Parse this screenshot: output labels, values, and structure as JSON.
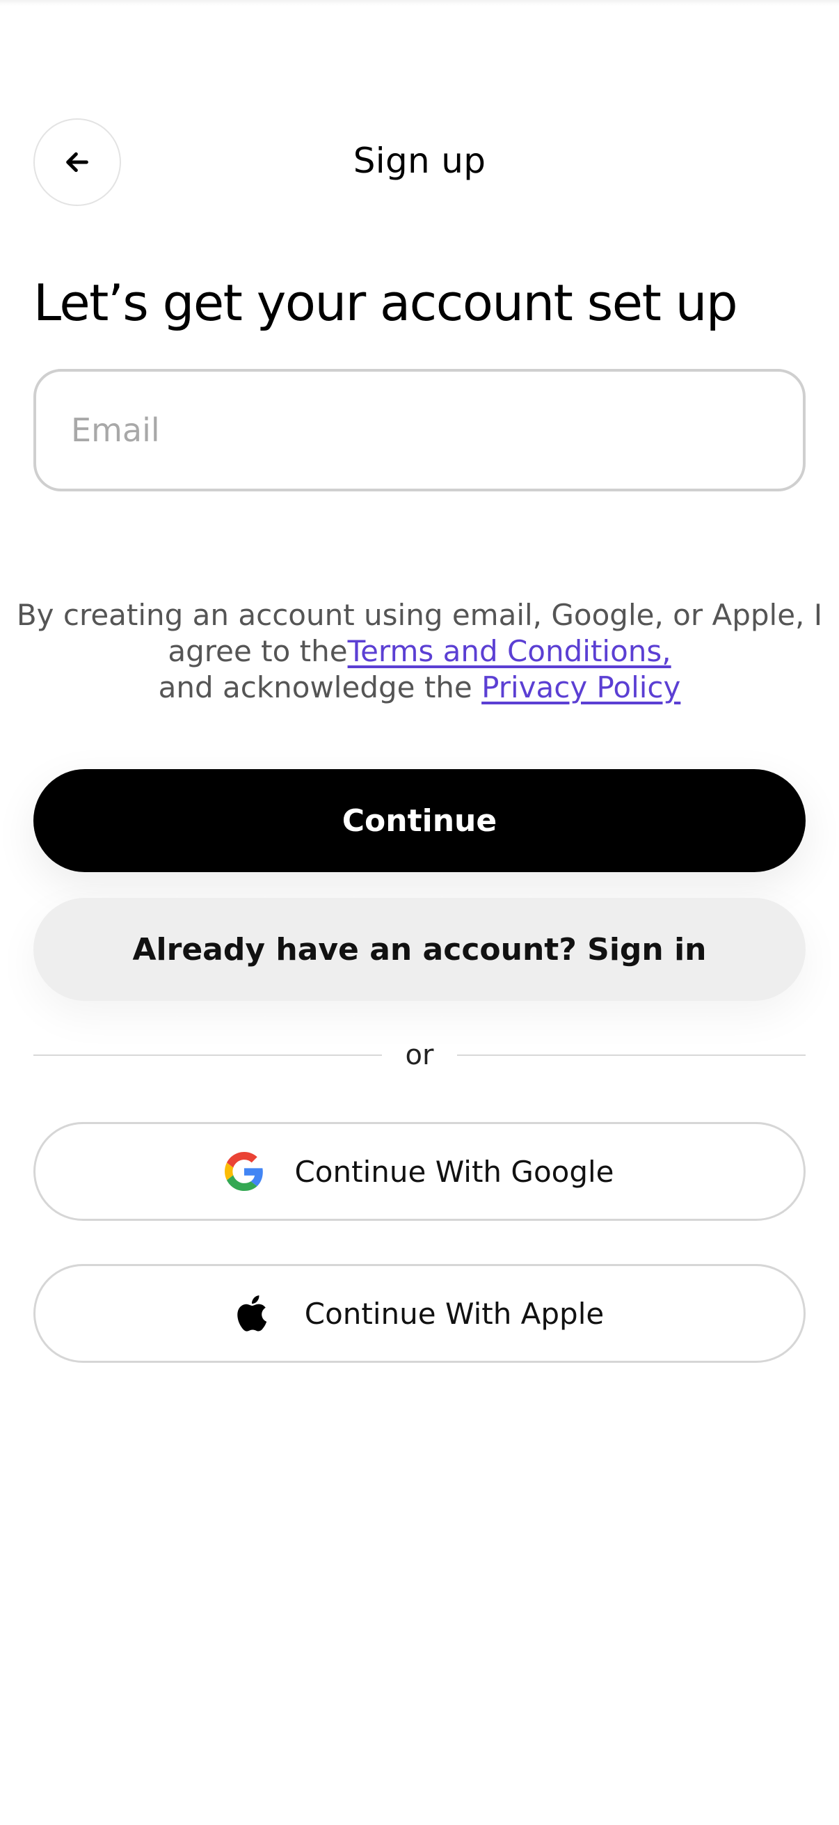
{
  "header": {
    "title": "Sign up",
    "back_icon": "arrow-left-icon"
  },
  "main": {
    "headline": "Let’s get your account set up",
    "email": {
      "placeholder": "Email",
      "value": ""
    },
    "legal": {
      "prefix": "By creating an account using email, Google, or Apple, I agree to the",
      "terms_link": "Terms and Conditions,",
      "middle": "and acknowledge the",
      "privacy_link": "Privacy Policy"
    },
    "continue_label": "Continue",
    "signin_label": "Already have an account? Sign in",
    "divider_label": "or",
    "google": {
      "label": "Continue With Google",
      "icon": "google-logo-icon"
    },
    "apple": {
      "label": "Continue With Apple",
      "icon": "apple-logo-icon"
    }
  },
  "colors": {
    "primary_button": "#000000",
    "secondary_button": "#eeeeee",
    "link": "#5b3fd3",
    "border": "#cfcfcf"
  }
}
